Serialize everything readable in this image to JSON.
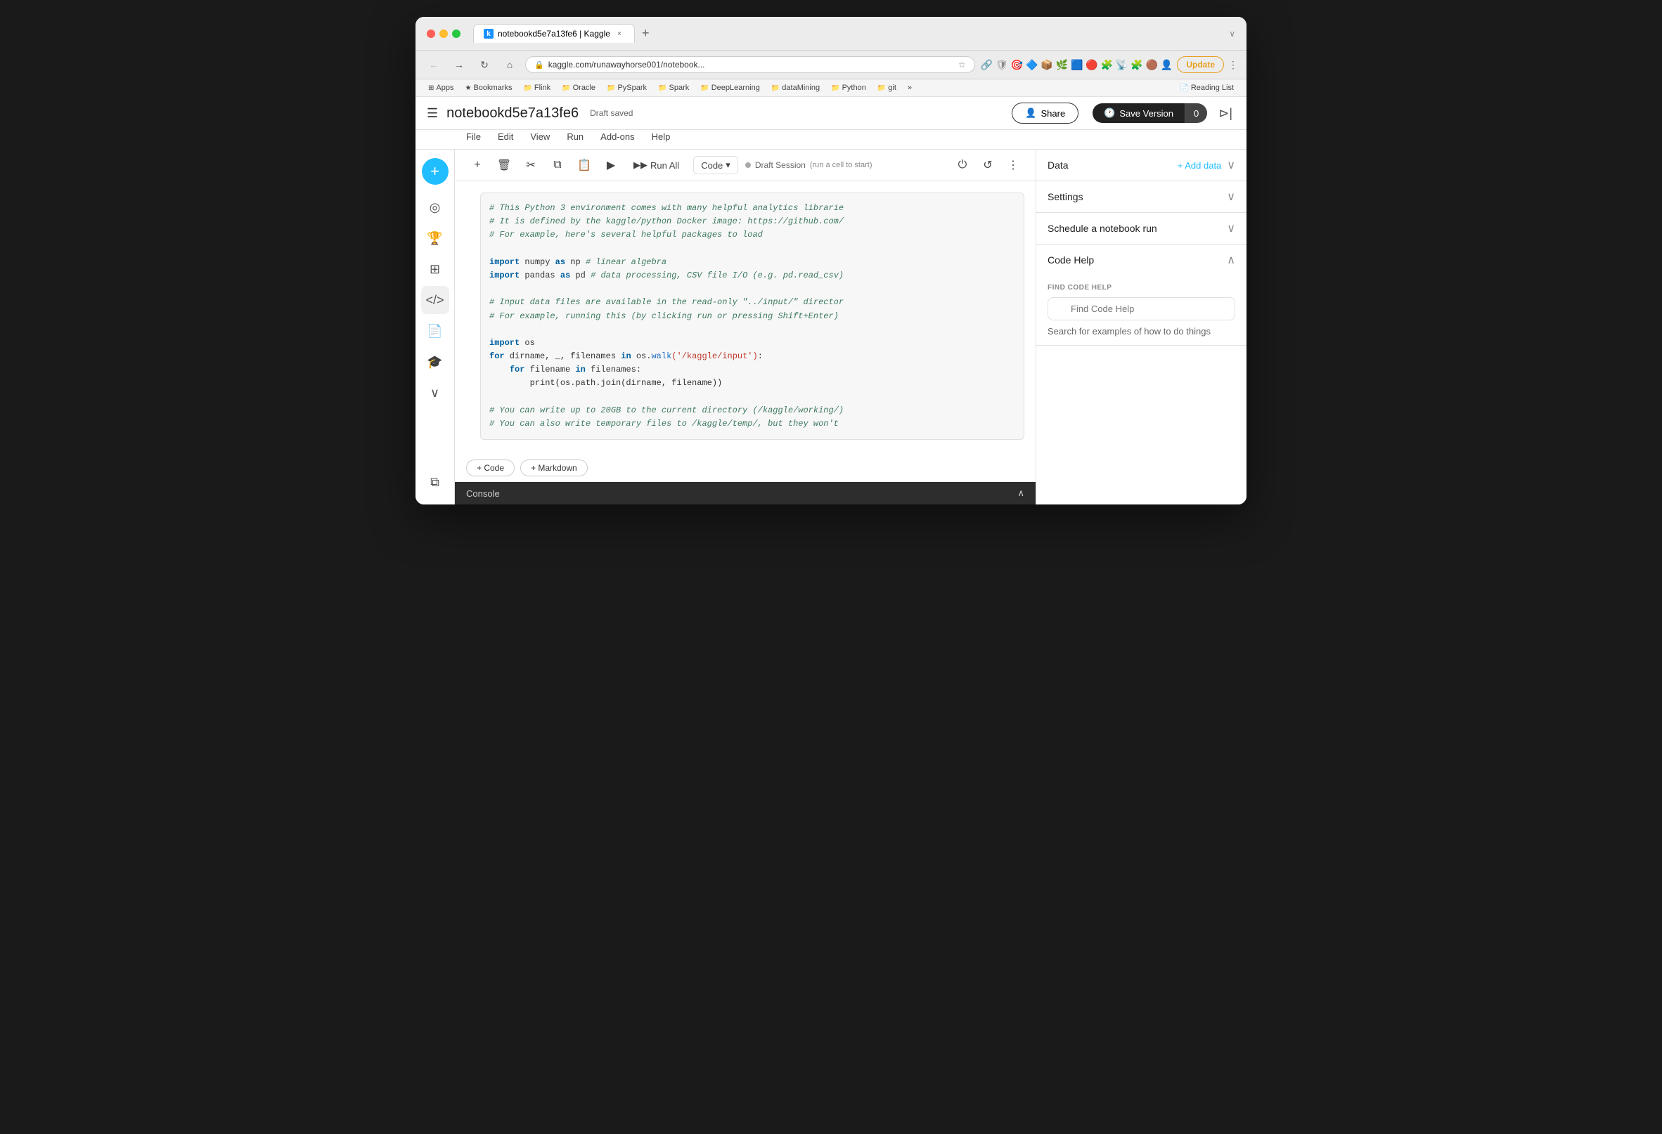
{
  "browser": {
    "tab_title": "notebookd5e7a13fe6 | Kaggle",
    "tab_close": "×",
    "new_tab": "+",
    "nav": {
      "back": "←",
      "forward": "→",
      "reload": "↻",
      "home": "⌂"
    },
    "address": "kaggle.com/runawayhorse001/notebook...",
    "update_btn": "Update",
    "collapse": "∨"
  },
  "bookmarks": [
    {
      "icon": "⊞",
      "label": "Apps"
    },
    {
      "icon": "★",
      "label": "Bookmarks"
    },
    {
      "icon": "📁",
      "label": "Flink"
    },
    {
      "icon": "📁",
      "label": "Oracle"
    },
    {
      "icon": "📁",
      "label": "PySpark"
    },
    {
      "icon": "📁",
      "label": "Spark"
    },
    {
      "icon": "📁",
      "label": "DeepLearning"
    },
    {
      "icon": "📁",
      "label": "dataMining"
    },
    {
      "icon": "📁",
      "label": "Python"
    },
    {
      "icon": "📁",
      "label": "git"
    },
    {
      "icon": "»",
      "label": ""
    },
    {
      "icon": "📄",
      "label": "Reading List"
    }
  ],
  "header": {
    "menu_icon": "☰",
    "title": "notebookd5e7a13fe6",
    "draft_status": "Draft saved",
    "share_label": "Share",
    "save_version_label": "Save Version",
    "save_version_count": "0",
    "collapse_panel": "⊳|"
  },
  "menu_bar": {
    "items": [
      "File",
      "Edit",
      "View",
      "Run",
      "Add-ons",
      "Help"
    ]
  },
  "toolbar": {
    "add": "+",
    "delete": "🗑",
    "cut": "✂",
    "copy": "⧉",
    "paste": "📋",
    "run": "▶",
    "run_all": "▶▶",
    "run_all_label": "Run All",
    "code_type": "Code",
    "code_dropdown": "▾",
    "session_label": "Draft Session",
    "session_sublabel": "(run a cell to",
    "session_sublabel2": "start)",
    "power": "⏻",
    "refresh": "↺",
    "more": "⋮"
  },
  "sidebar": {
    "plus": "+",
    "icons": [
      {
        "name": "compass",
        "symbol": "◎"
      },
      {
        "name": "trophy",
        "symbol": "🏆"
      },
      {
        "name": "table",
        "symbol": "⊞"
      },
      {
        "name": "code",
        "symbol": "</>"
      },
      {
        "name": "document",
        "symbol": "📄"
      },
      {
        "name": "graduation",
        "symbol": "🎓"
      },
      {
        "name": "more",
        "symbol": "∨"
      },
      {
        "name": "copy-layers",
        "symbol": "⧉"
      }
    ]
  },
  "code_cell": {
    "lines": [
      {
        "type": "comment",
        "text": "# This Python 3 environment comes with many helpful analytics librarie"
      },
      {
        "type": "comment",
        "text": "# It is defined by the kaggle/python Docker image: https://github.com/"
      },
      {
        "type": "comment",
        "text": "# For example, here's several helpful packages to load"
      },
      {
        "type": "blank",
        "text": ""
      },
      {
        "type": "import",
        "keyword": "import",
        "rest": " numpy ",
        "as": "as",
        "alias": " np ",
        "comment": "# linear algebra"
      },
      {
        "type": "import",
        "keyword": "import",
        "rest": " pandas ",
        "as": "as",
        "alias": " pd ",
        "comment": "# data processing, CSV file I/O (e.g. pd.read_csv)"
      },
      {
        "type": "blank",
        "text": ""
      },
      {
        "type": "comment",
        "text": "# Input data files are available in the read-only \"../input/\" director"
      },
      {
        "type": "comment",
        "text": "# For example, running this (by clicking run or pressing Shift+Enter)"
      },
      {
        "type": "blank",
        "text": ""
      },
      {
        "type": "code",
        "keyword": "import",
        "rest": " os"
      },
      {
        "type": "for",
        "keyword": "for",
        "rest": " dirname, _, filenames ",
        "in_kw": "in",
        "func": " os.walk",
        "string": "('/kaggle/input')",
        "end": ":"
      },
      {
        "type": "for2",
        "keyword": "    for",
        "rest": " filename ",
        "in_kw": "in",
        "end": " filenames:"
      },
      {
        "type": "print",
        "rest": "        print(os.path.join(dirname, filename))"
      },
      {
        "type": "blank",
        "text": ""
      },
      {
        "type": "comment",
        "text": "# You can write up to 20GB to the current directory (/kaggle/working/)"
      },
      {
        "type": "comment",
        "text": "# You can also write temporary files to /kaggle/temp/, but they won't"
      }
    ]
  },
  "add_cell": {
    "code_btn": "+ Code",
    "markdown_btn": "+ Markdown"
  },
  "console": {
    "label": "Console",
    "collapse_icon": "∧"
  },
  "right_panel": {
    "data_section": {
      "title": "Data",
      "add_data": "+ Add data",
      "chevron": "∨"
    },
    "settings_section": {
      "title": "Settings",
      "chevron": "∨"
    },
    "schedule_section": {
      "title": "Schedule a notebook run",
      "chevron": "∨"
    },
    "code_help_section": {
      "title": "Code Help",
      "chevron": "∧",
      "find_label": "FIND CODE HELP",
      "placeholder": "Find Code Help",
      "hint": "Search for examples of how to do things"
    }
  }
}
